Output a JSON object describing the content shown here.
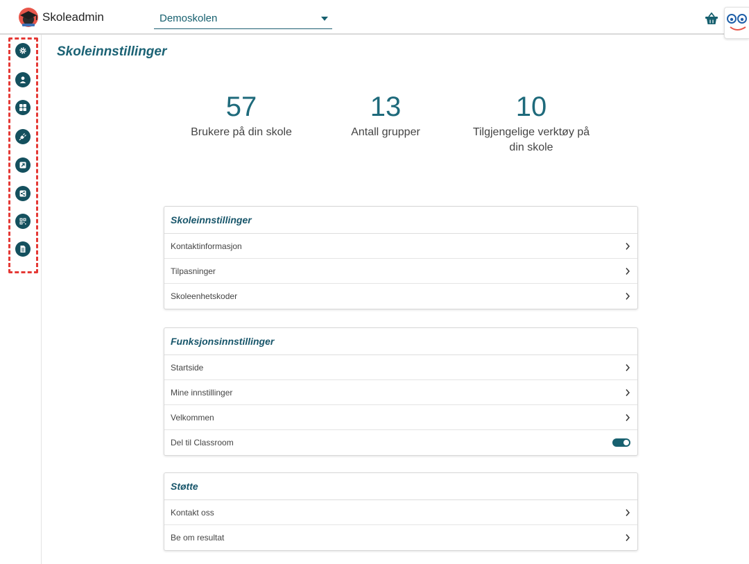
{
  "header": {
    "brand_name": "Skoleadmin",
    "school_name": "Demoskolen"
  },
  "sidebar": {
    "items": [
      {
        "name": "settings",
        "icon": "gear-icon"
      },
      {
        "name": "users",
        "icon": "user-icon"
      },
      {
        "name": "groups",
        "icon": "grid-icon"
      },
      {
        "name": "tools",
        "icon": "plug-icon"
      },
      {
        "name": "external",
        "icon": "external-link-icon"
      },
      {
        "name": "share",
        "icon": "share-icon"
      },
      {
        "name": "qr",
        "icon": "qr-code-icon"
      },
      {
        "name": "documents",
        "icon": "document-icon"
      }
    ]
  },
  "main": {
    "title": "Skoleinnstillinger",
    "stats": [
      {
        "value": "57",
        "label": "Brukere på din skole"
      },
      {
        "value": "13",
        "label": "Antall grupper"
      },
      {
        "value": "10",
        "label": "Tilgjengelige verktøy på din skole"
      }
    ],
    "sections": [
      {
        "title": "Skoleinnstillinger",
        "rows": [
          "Kontaktinformasjon",
          "Tilpasninger",
          "Skoleenhetskoder"
        ]
      },
      {
        "title": "Funksjonsinnstillinger",
        "rows": [
          "Startside",
          "Mine innstillinger",
          "Velkommen",
          "Del til Classroom"
        ]
      },
      {
        "title": "Støtte",
        "rows": [
          "Kontakt oss",
          "Be om resultat"
        ]
      }
    ]
  },
  "colors": {
    "accent": "#17606f",
    "sidebar_icon_bg": "#14505e",
    "highlight_dashed": "#e53935"
  }
}
